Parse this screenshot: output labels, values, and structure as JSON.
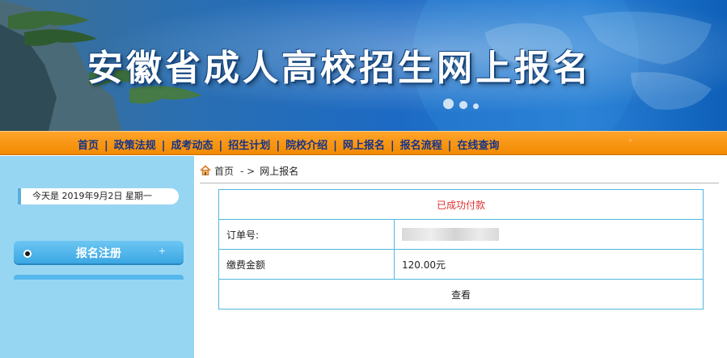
{
  "banner": {
    "title": "安徽省成人高校招生网上报名"
  },
  "nav": {
    "items": [
      "首页",
      "政策法规",
      "成考动态",
      "招生计划",
      "院校介绍",
      "网上报名",
      "报名流程",
      "在线查询"
    ],
    "separator": "|",
    "trailing": "◦"
  },
  "sidebar": {
    "date_text": "今天是 2019年9月2日 星期一",
    "register_label": "报名注册",
    "register_plus": "+"
  },
  "breadcrumb": {
    "home": "首页",
    "separator": "- >",
    "current": "网上报名"
  },
  "result": {
    "status": "已成功付款",
    "order_label": "订单号:",
    "amount_label": "缴费金额",
    "amount_value": "120.00元",
    "view_label": "查看"
  },
  "colors": {
    "nav_bg": "#f28a00",
    "nav_text": "#14338a",
    "sidebar_bg": "#97d6f2",
    "table_border": "#50b8de",
    "status_red": "#e03030"
  }
}
